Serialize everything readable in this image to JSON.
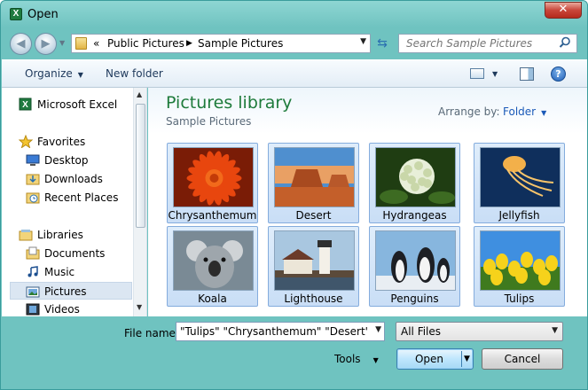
{
  "window": {
    "title": "Open",
    "close_glyph": "✕"
  },
  "address_bar": {
    "chevrons": "«",
    "path": [
      "Public Pictures",
      "Sample Pictures"
    ]
  },
  "search": {
    "placeholder": "Search Sample Pictures"
  },
  "toolbar": {
    "organize_label": "Organize",
    "new_folder_label": "New folder"
  },
  "nav_pane": {
    "items": [
      {
        "label": "Microsoft Excel",
        "icon": "excel-icon",
        "group": true
      },
      {
        "label": "Favorites",
        "icon": "star-icon",
        "group": true
      },
      {
        "label": "Desktop",
        "icon": "desktop-icon",
        "group": false
      },
      {
        "label": "Downloads",
        "icon": "downloads-folder-icon",
        "group": false
      },
      {
        "label": "Recent Places",
        "icon": "recent-places-icon",
        "group": false
      },
      {
        "label": "Libraries",
        "icon": "libraries-icon",
        "group": true
      },
      {
        "label": "Documents",
        "icon": "documents-icon",
        "group": false
      },
      {
        "label": "Music",
        "icon": "music-icon",
        "group": false
      },
      {
        "label": "Pictures",
        "icon": "pictures-icon",
        "group": false,
        "selected": true
      },
      {
        "label": "Videos",
        "icon": "videos-icon",
        "group": false
      }
    ]
  },
  "library": {
    "title": "Pictures library",
    "subtitle": "Sample Pictures",
    "arrange_by_label": "Arrange by:",
    "arrange_by_value": "Folder"
  },
  "files": [
    {
      "name": "Chrysanthemum",
      "selected": true
    },
    {
      "name": "Desert",
      "selected": true
    },
    {
      "name": "Hydrangeas",
      "selected": true
    },
    {
      "name": "Jellyfish",
      "selected": true
    },
    {
      "name": "Koala",
      "selected": true
    },
    {
      "name": "Lighthouse",
      "selected": true
    },
    {
      "name": "Penguins",
      "selected": true
    },
    {
      "name": "Tulips",
      "selected": true
    }
  ],
  "bottom": {
    "file_name_label": "File name:",
    "file_name_value": "\"Tulips\" \"Chrysanthemum\" \"Desert\" \"Hy",
    "file_type_value": "All Files",
    "tools_label": "Tools",
    "open_label": "Open",
    "cancel_label": "Cancel"
  },
  "colors": {
    "accent": "#1e7b3b",
    "link": "#1b5ab8",
    "selection": "#c9def6"
  }
}
